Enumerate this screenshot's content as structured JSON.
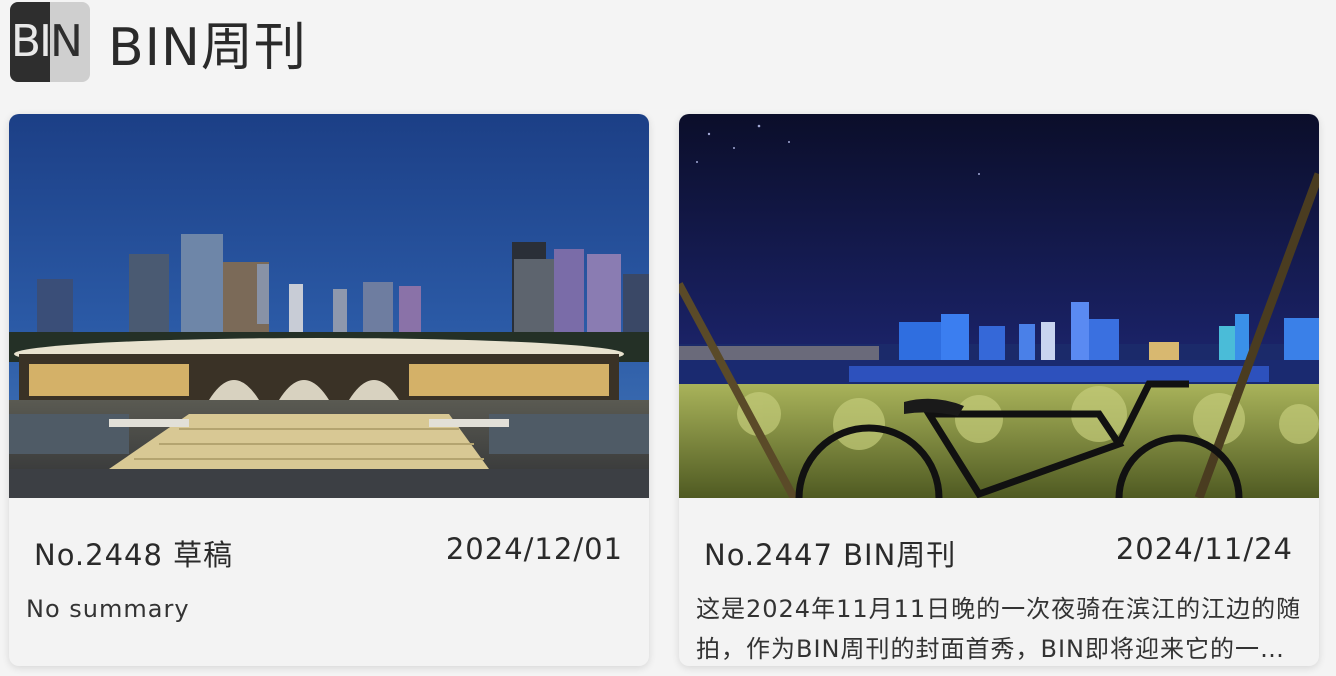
{
  "header": {
    "logo_left": "BI",
    "logo_right": "N",
    "title": "BIN周刊"
  },
  "posts": [
    {
      "number": "No.2448 草稿",
      "date": "2024/12/01",
      "summary": "No summary"
    },
    {
      "number": "No.2447 BIN周刊",
      "date": "2024/11/24",
      "summary": "这是2024年11月11日晚的一次夜骑在滨江的江边的随拍，作为BIN周刊的封面首秀，BIN即将迎来它的一周年"
    }
  ],
  "colors": {
    "background": "#f4f4f4",
    "card": "#f3f3f3",
    "text": "#2b2b2b"
  }
}
